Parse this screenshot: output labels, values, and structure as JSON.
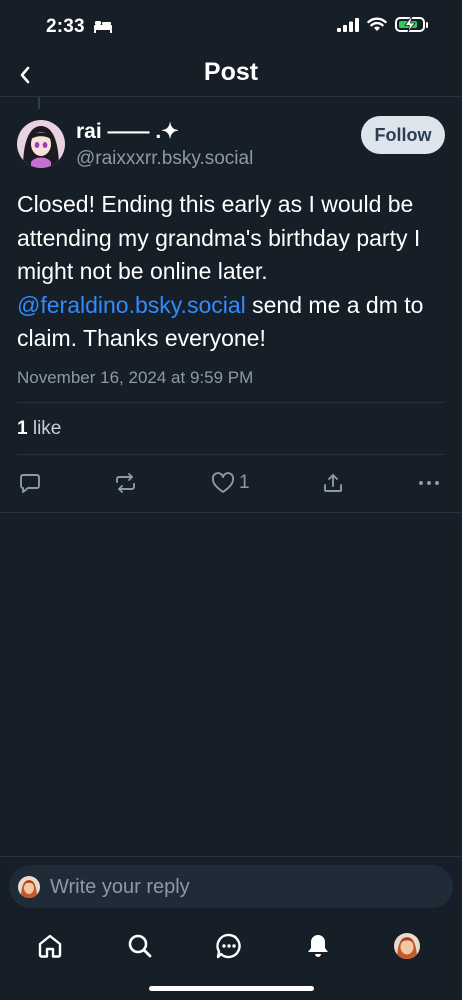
{
  "status_bar": {
    "time": "2:33"
  },
  "header": {
    "title": "Post"
  },
  "post": {
    "author_name": "rai —— .✦",
    "author_handle": "@raixxxrr.bsky.social",
    "follow_label": "Follow",
    "text_1": "Closed! Ending this early as I would be attending my grandma's birthday party I might not be online later. ",
    "mention": "@feraldino.bsky.social",
    "text_2": " send me a dm to claim. Thanks everyone!",
    "date": "November 16, 2024 at 9:59 PM",
    "like_count": "1",
    "like_word": " like",
    "action_like_count": "1"
  },
  "composer": {
    "placeholder": "Write your reply"
  },
  "colors": {
    "background": "#161e27",
    "accent_link": "#2f8cff",
    "muted": "#8d99a7",
    "follow_bg": "#dde4ec",
    "battery_green": "#34c759"
  },
  "icons": [
    "back-icon",
    "comment-icon",
    "repost-icon",
    "heart-icon",
    "share-icon",
    "more-icon",
    "home-icon",
    "search-icon",
    "chat-icon",
    "bell-icon",
    "profile-avatar"
  ]
}
